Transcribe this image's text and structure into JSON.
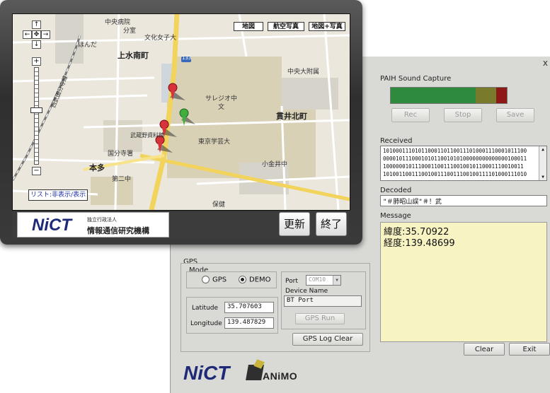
{
  "sound_capture": {
    "title": "PAIH Sound Capture",
    "rec_label": "Rec",
    "stop_label": "Stop",
    "save_label": "Save",
    "level_colors": [
      "#2e8b3d",
      "#2e8b3d",
      "#7a7a2c",
      "#8c1818"
    ]
  },
  "received": {
    "title": "Received",
    "lines": [
      "101000111010110001101100111010001110001011100",
      "000010111000101011001010100000000000000100011",
      "10000001011100011001110010010110001110010011",
      "101001100111001001110011100100111101000111010"
    ]
  },
  "decoded": {
    "title": "Decoded",
    "value": "\"＃肺昭山誤\"＃！武"
  },
  "message": {
    "title": "Message",
    "lat_line": "緯度:35.70922",
    "lon_line": "経度:139.48699"
  },
  "gps": {
    "title": "GPS",
    "mode_title": "Mode",
    "mode_gps": "GPS",
    "mode_demo": "DEMO",
    "latitude_label": "Latitude",
    "latitude_value": "35.707603",
    "longitude_label": "Longitude",
    "longitude_value": "139.487829",
    "port_label": "Port",
    "port_value": "COM10",
    "device_name_label": "Device Name",
    "device_name_value": "BT Port",
    "run_label": "GPS Run",
    "log_clear_label": "GPS Log Clear"
  },
  "buttons": {
    "clear": "Clear",
    "exit": "Exit"
  },
  "window": {
    "close_glyph": "x"
  },
  "bottom_logos": {
    "nict": "NiCT",
    "animo": "ANiMO"
  },
  "map": {
    "type_buttons": [
      "地図",
      "航空写真",
      "地図+写真"
    ],
    "nav_up": "↑",
    "nav_left": "←",
    "nav_center": "✥",
    "nav_right": "→",
    "nav_down": "↓",
    "zoom_in": "+",
    "zoom_out": "−",
    "list_toggle": "リスト:非表示/表示",
    "labels": {
      "kamimizu": "上水南町",
      "nukuikitamachi": "貫井北町",
      "honda": "本多",
      "bunka": "文化女子大",
      "sarejio": "サレジオ中",
      "gakugei": "東京学芸大",
      "koganei": "小金井中",
      "nakaoo": "中央大附属",
      "kokubunji": "国分寺署",
      "daini": "第二中",
      "hoken": "保健",
      "chuo_byoin": "中央病院",
      "bunshitsu": "分室",
      "honda_jinja": "ほんだ",
      "shiryo": "武蔵野資料館",
      "mon": "文",
      "route": "133",
      "nishi": "西武国分寺線"
    }
  },
  "popup_footer": {
    "nict": "NiCT",
    "org_small": "独立行政法人",
    "org_name": "情報通信研究機構",
    "update_btn": "更新",
    "exit_btn": "終了"
  }
}
